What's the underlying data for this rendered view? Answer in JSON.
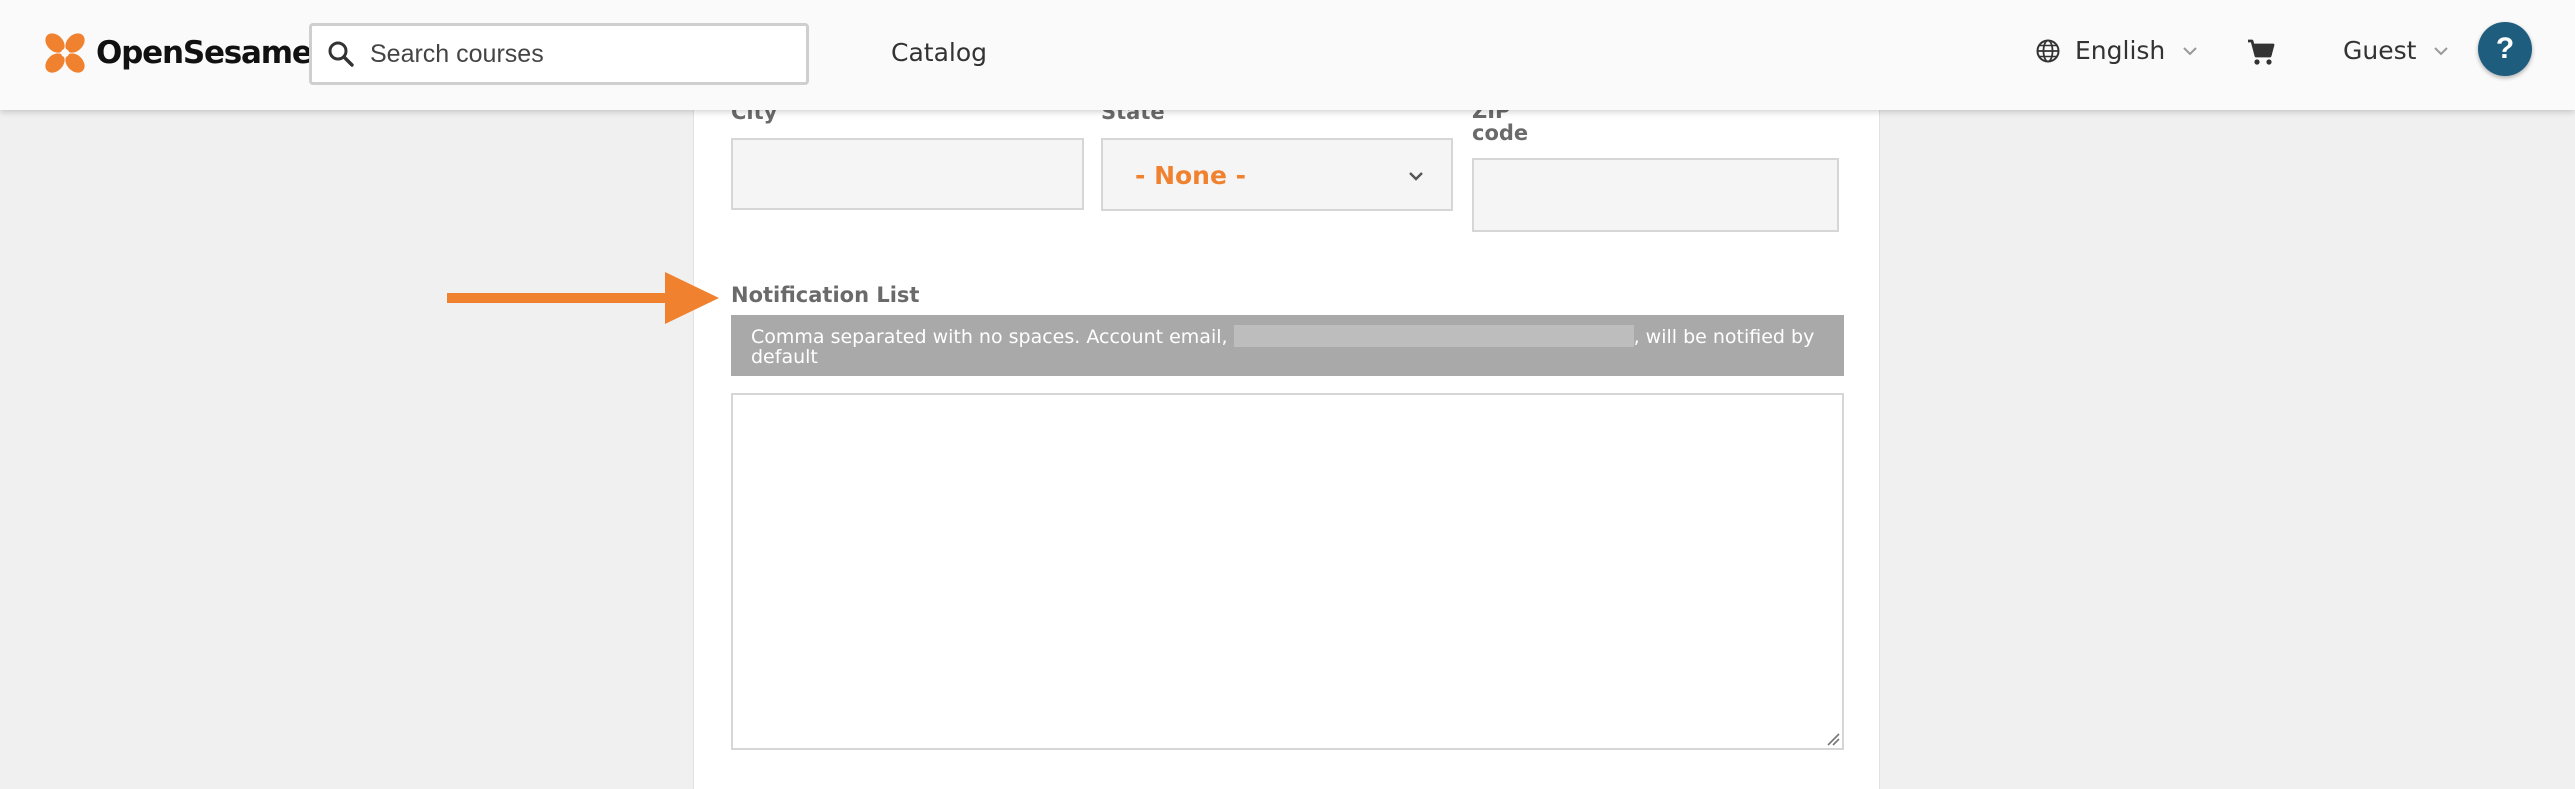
{
  "header": {
    "brand": "OpenSesame",
    "search_placeholder": "Search courses",
    "nav_catalog": "Catalog",
    "language": "English",
    "user": "Guest",
    "help": "?"
  },
  "form": {
    "city_label": "City",
    "state_label": "State",
    "state_value": "- None -",
    "zip_label_line1": "ZIP",
    "zip_label_line2": "code",
    "notification_label": "Notification List",
    "notification_help_prefix": "Comma separated with no spaces. Account email, ",
    "notification_help_suffix": ", will be notified by",
    "notification_help_line2": "default",
    "notification_value": ""
  },
  "colors": {
    "brand_orange": "#f0822f",
    "help_blue": "#1f5d7e",
    "help_bar": "#a9a9a9"
  },
  "icons": {
    "search": "search-icon",
    "globe": "globe-icon",
    "cart": "cart-icon",
    "chevron": "chevron-down-icon",
    "arrow": "annotation-arrow"
  }
}
